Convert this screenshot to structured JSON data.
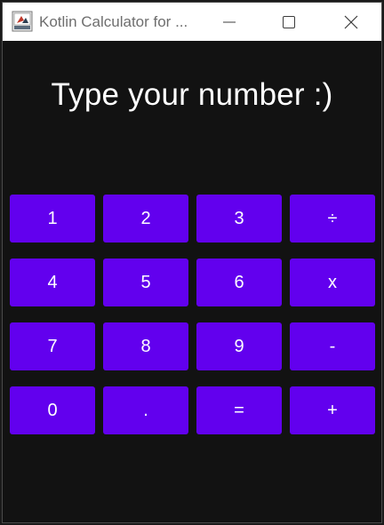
{
  "window": {
    "title": "Kotlin Calculator for ..."
  },
  "icons": {
    "app": "app-icon",
    "minimize": "minimize-icon",
    "maximize": "maximize-icon",
    "close": "close-icon"
  },
  "display": {
    "text": "Type your number :)"
  },
  "keys": {
    "k1": "1",
    "k2": "2",
    "k3": "3",
    "divide": "÷",
    "k4": "4",
    "k5": "5",
    "k6": "6",
    "multiply": "x",
    "k7": "7",
    "k8": "8",
    "k9": "9",
    "minus": "-",
    "k0": "0",
    "dot": ".",
    "equals": "=",
    "plus": "+"
  },
  "colors": {
    "key_background": "#6200ee",
    "window_background": "#121212",
    "titlebar": "#ffffff"
  }
}
